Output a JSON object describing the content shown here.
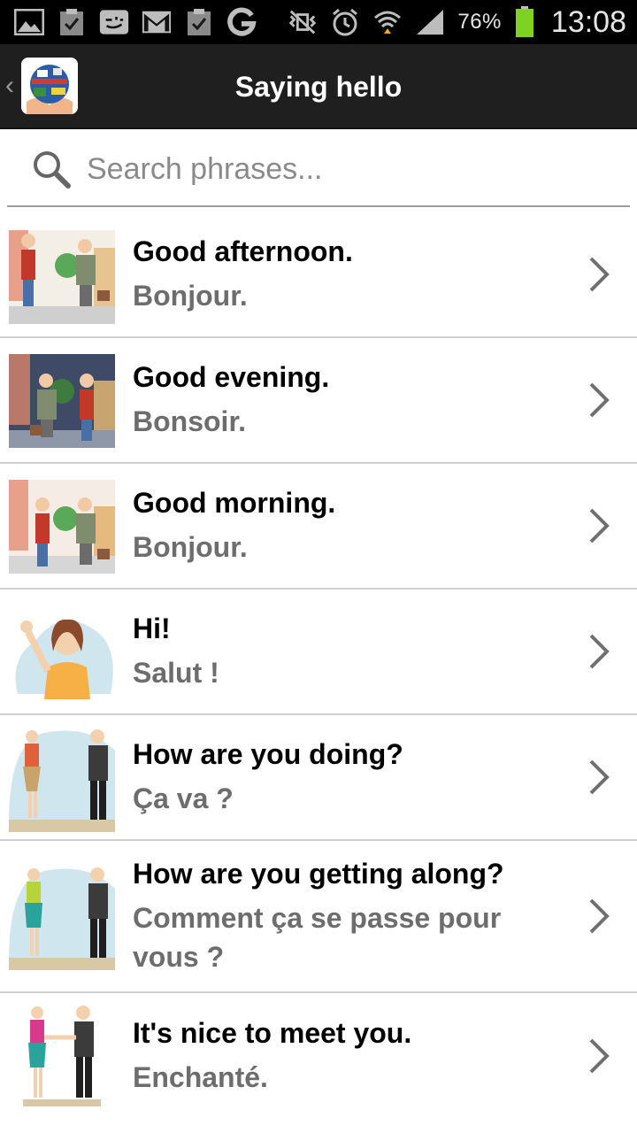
{
  "status_bar": {
    "battery_percent": "76%",
    "time": "13:08",
    "icons": [
      "gallery-icon",
      "clipboard-check-icon",
      "smiley-message-icon",
      "gmail-icon",
      "clipboard-check-icon",
      "google-icon",
      "mute-vibrate-icon",
      "alarm-icon",
      "wifi-icon",
      "signal-icon",
      "battery-icon"
    ]
  },
  "action_bar": {
    "title": "Saying hello"
  },
  "search": {
    "placeholder": "Search phrases..."
  },
  "phrases": [
    {
      "en": "Good afternoon.",
      "fr": "Bonjour."
    },
    {
      "en": "Good evening.",
      "fr": "Bonsoir."
    },
    {
      "en": "Good morning.",
      "fr": "Bonjour."
    },
    {
      "en": "Hi!",
      "fr": "Salut !"
    },
    {
      "en": "How are you doing?",
      "fr": "Ça va ?"
    },
    {
      "en": "How are you getting along?",
      "fr": "Comment ça se passe pour vous ?"
    },
    {
      "en": "It's nice to meet you.",
      "fr": "Enchanté."
    }
  ],
  "colors": {
    "status_bar_bg": "#000000",
    "action_bar_bg": "#1f1f1f",
    "battery_green": "#7ed321",
    "secondary_text": "#6d6d6d",
    "divider": "#d0d0d0"
  }
}
